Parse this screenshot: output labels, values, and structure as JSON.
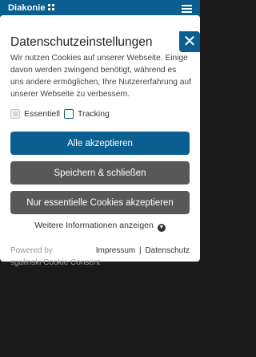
{
  "header": {
    "brand": "Diakonie"
  },
  "dialog": {
    "close_symbol": "✕",
    "title": "Datenschutzeinstellungen",
    "description": "Wir nutzen Cookies auf unserer Webseite. Einige davon werden zwingend benötigt, während es uns andere ermöglichen, Ihre Nutzererfahrung auf unserer Webseite zu verbessern.",
    "options": [
      {
        "label": "Essentiell",
        "checked": true,
        "disabled": true
      },
      {
        "label": "Tracking",
        "checked": false,
        "disabled": false
      }
    ],
    "buttons": {
      "accept_all": "Alle akzeptieren",
      "save_close": "Speichern & schließen",
      "essential_only": "Nur essentielle Cookies akzeptieren"
    },
    "more_info": "Weitere Informationen anzeigen",
    "powered_by": "Powered by",
    "vendor": "sgalinski Cookie Consent",
    "links": {
      "imprint": "Impressum",
      "separator": "|",
      "privacy": "Datenschutz"
    }
  },
  "colors": {
    "primary": "#0a5f90",
    "secondary_button": "#585858",
    "backdrop": "#1a1a1a"
  },
  "icons": {
    "menu": "hamburger-icon",
    "close": "close-icon",
    "more": "chevron-down-icon"
  }
}
